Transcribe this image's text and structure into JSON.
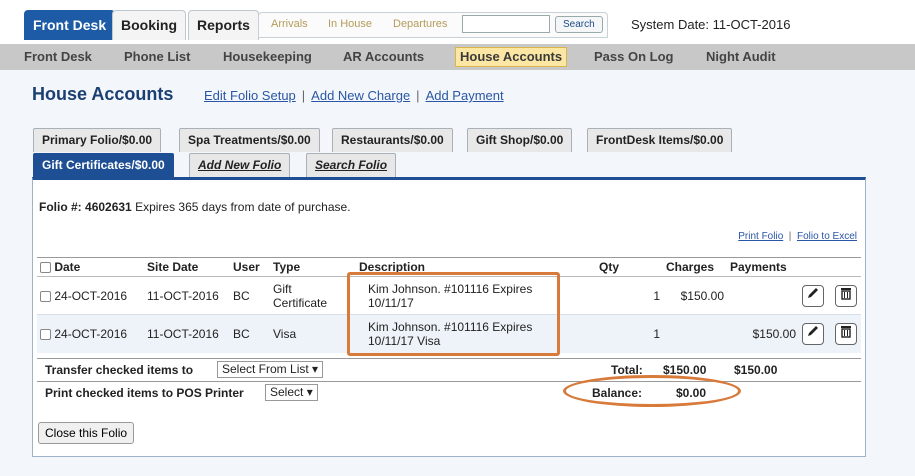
{
  "main_tabs": [
    "Front Desk",
    "Booking",
    "Reports"
  ],
  "sub_tabs": [
    "Arrivals",
    "In House",
    "Departures"
  ],
  "search": {
    "value": "",
    "button": "Search"
  },
  "system_date": "System Date: 11-OCT-2016",
  "nav": [
    "Front Desk",
    "Phone List",
    "Housekeeping",
    "AR Accounts",
    "House Accounts",
    "Pass On Log",
    "Night Audit"
  ],
  "nav_active": "House Accounts",
  "page_title": "House Accounts",
  "header_links": [
    "Edit Folio Setup",
    "Add New Charge",
    "Add Payment"
  ],
  "folio_tabs_row1": [
    "Primary Folio/$0.00",
    "Spa Treatments/$0.00",
    "Restaurants/$0.00",
    "Gift Shop/$0.00",
    "FrontDesk Items/$0.00"
  ],
  "folio_tabs_row2": [
    "Gift Certificates/$0.00",
    "Add New Folio",
    "Search Folio"
  ],
  "folio": {
    "label": "Folio #:",
    "number": "4602631",
    "note": "Expires 365 days from date of purchase."
  },
  "print_links": [
    "Print Folio",
    "Folio to Excel"
  ],
  "columns": [
    "Date",
    "Site Date",
    "User",
    "Type",
    "Description",
    "Qty",
    "Charges",
    "Payments"
  ],
  "rows": [
    {
      "date": "24-OCT-2016",
      "site_date": "11-OCT-2016",
      "user": "BC",
      "type_l1": "Gift",
      "type_l2": "Certificate",
      "desc_l1": "Kim Johnson. #101116 Expires",
      "desc_l2": "10/11/17",
      "qty": "1",
      "charges": "$150.00",
      "payments": ""
    },
    {
      "date": "24-OCT-2016",
      "site_date": "11-OCT-2016",
      "user": "BC",
      "type_l1": "Visa",
      "type_l2": "",
      "desc_l1": "Kim Johnson. #101116 Expires",
      "desc_l2": "10/11/17 Visa",
      "qty": "1",
      "charges": "",
      "payments": "$150.00"
    }
  ],
  "transfer": {
    "label": "Transfer checked items to",
    "select": "Select From List"
  },
  "print_pos": {
    "label": "Print checked items to POS Printer",
    "select": "Select"
  },
  "totals": {
    "total_label": "Total:",
    "charges": "$150.00",
    "payments": "$150.00",
    "balance_label": "Balance:",
    "balance": "$0.00"
  },
  "close_button": "Close this Folio",
  "colors": {
    "accent": "#1e5ba6",
    "annotation": "#d77a3a",
    "highlight": "#fbe7a3"
  }
}
